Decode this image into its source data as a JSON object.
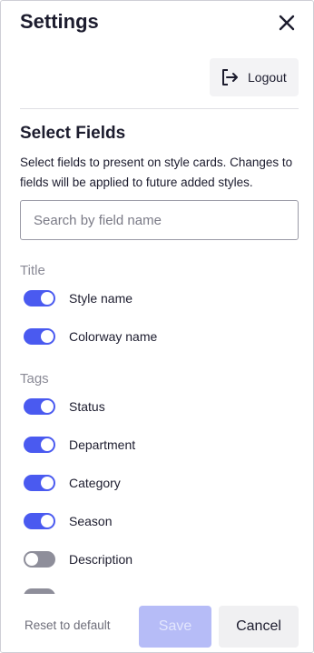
{
  "header": {
    "title": "Settings",
    "close_icon": "close-icon"
  },
  "logout": {
    "label": "Logout",
    "icon": "logout-icon"
  },
  "section": {
    "title": "Select Fields",
    "description": "Select fields to present on style cards. Changes to fields will be applied to future added styles."
  },
  "search": {
    "placeholder": "Search by field name",
    "value": ""
  },
  "groups": {
    "title": {
      "label": "Title",
      "items": [
        {
          "label": "Style name",
          "enabled": true
        },
        {
          "label": "Colorway name",
          "enabled": true
        }
      ]
    },
    "tags": {
      "label": "Tags",
      "items": [
        {
          "label": "Status",
          "enabled": true
        },
        {
          "label": "Department",
          "enabled": true
        },
        {
          "label": "Category",
          "enabled": true
        },
        {
          "label": "Season",
          "enabled": true
        },
        {
          "label": "Description",
          "enabled": false
        }
      ]
    }
  },
  "footer": {
    "reset_label": "Reset to default",
    "save_label": "Save",
    "cancel_label": "Cancel"
  },
  "colors": {
    "accent": "#4a5af0",
    "toggle_off": "#8e8e9a",
    "save_disabled": "#b6bcf7"
  }
}
